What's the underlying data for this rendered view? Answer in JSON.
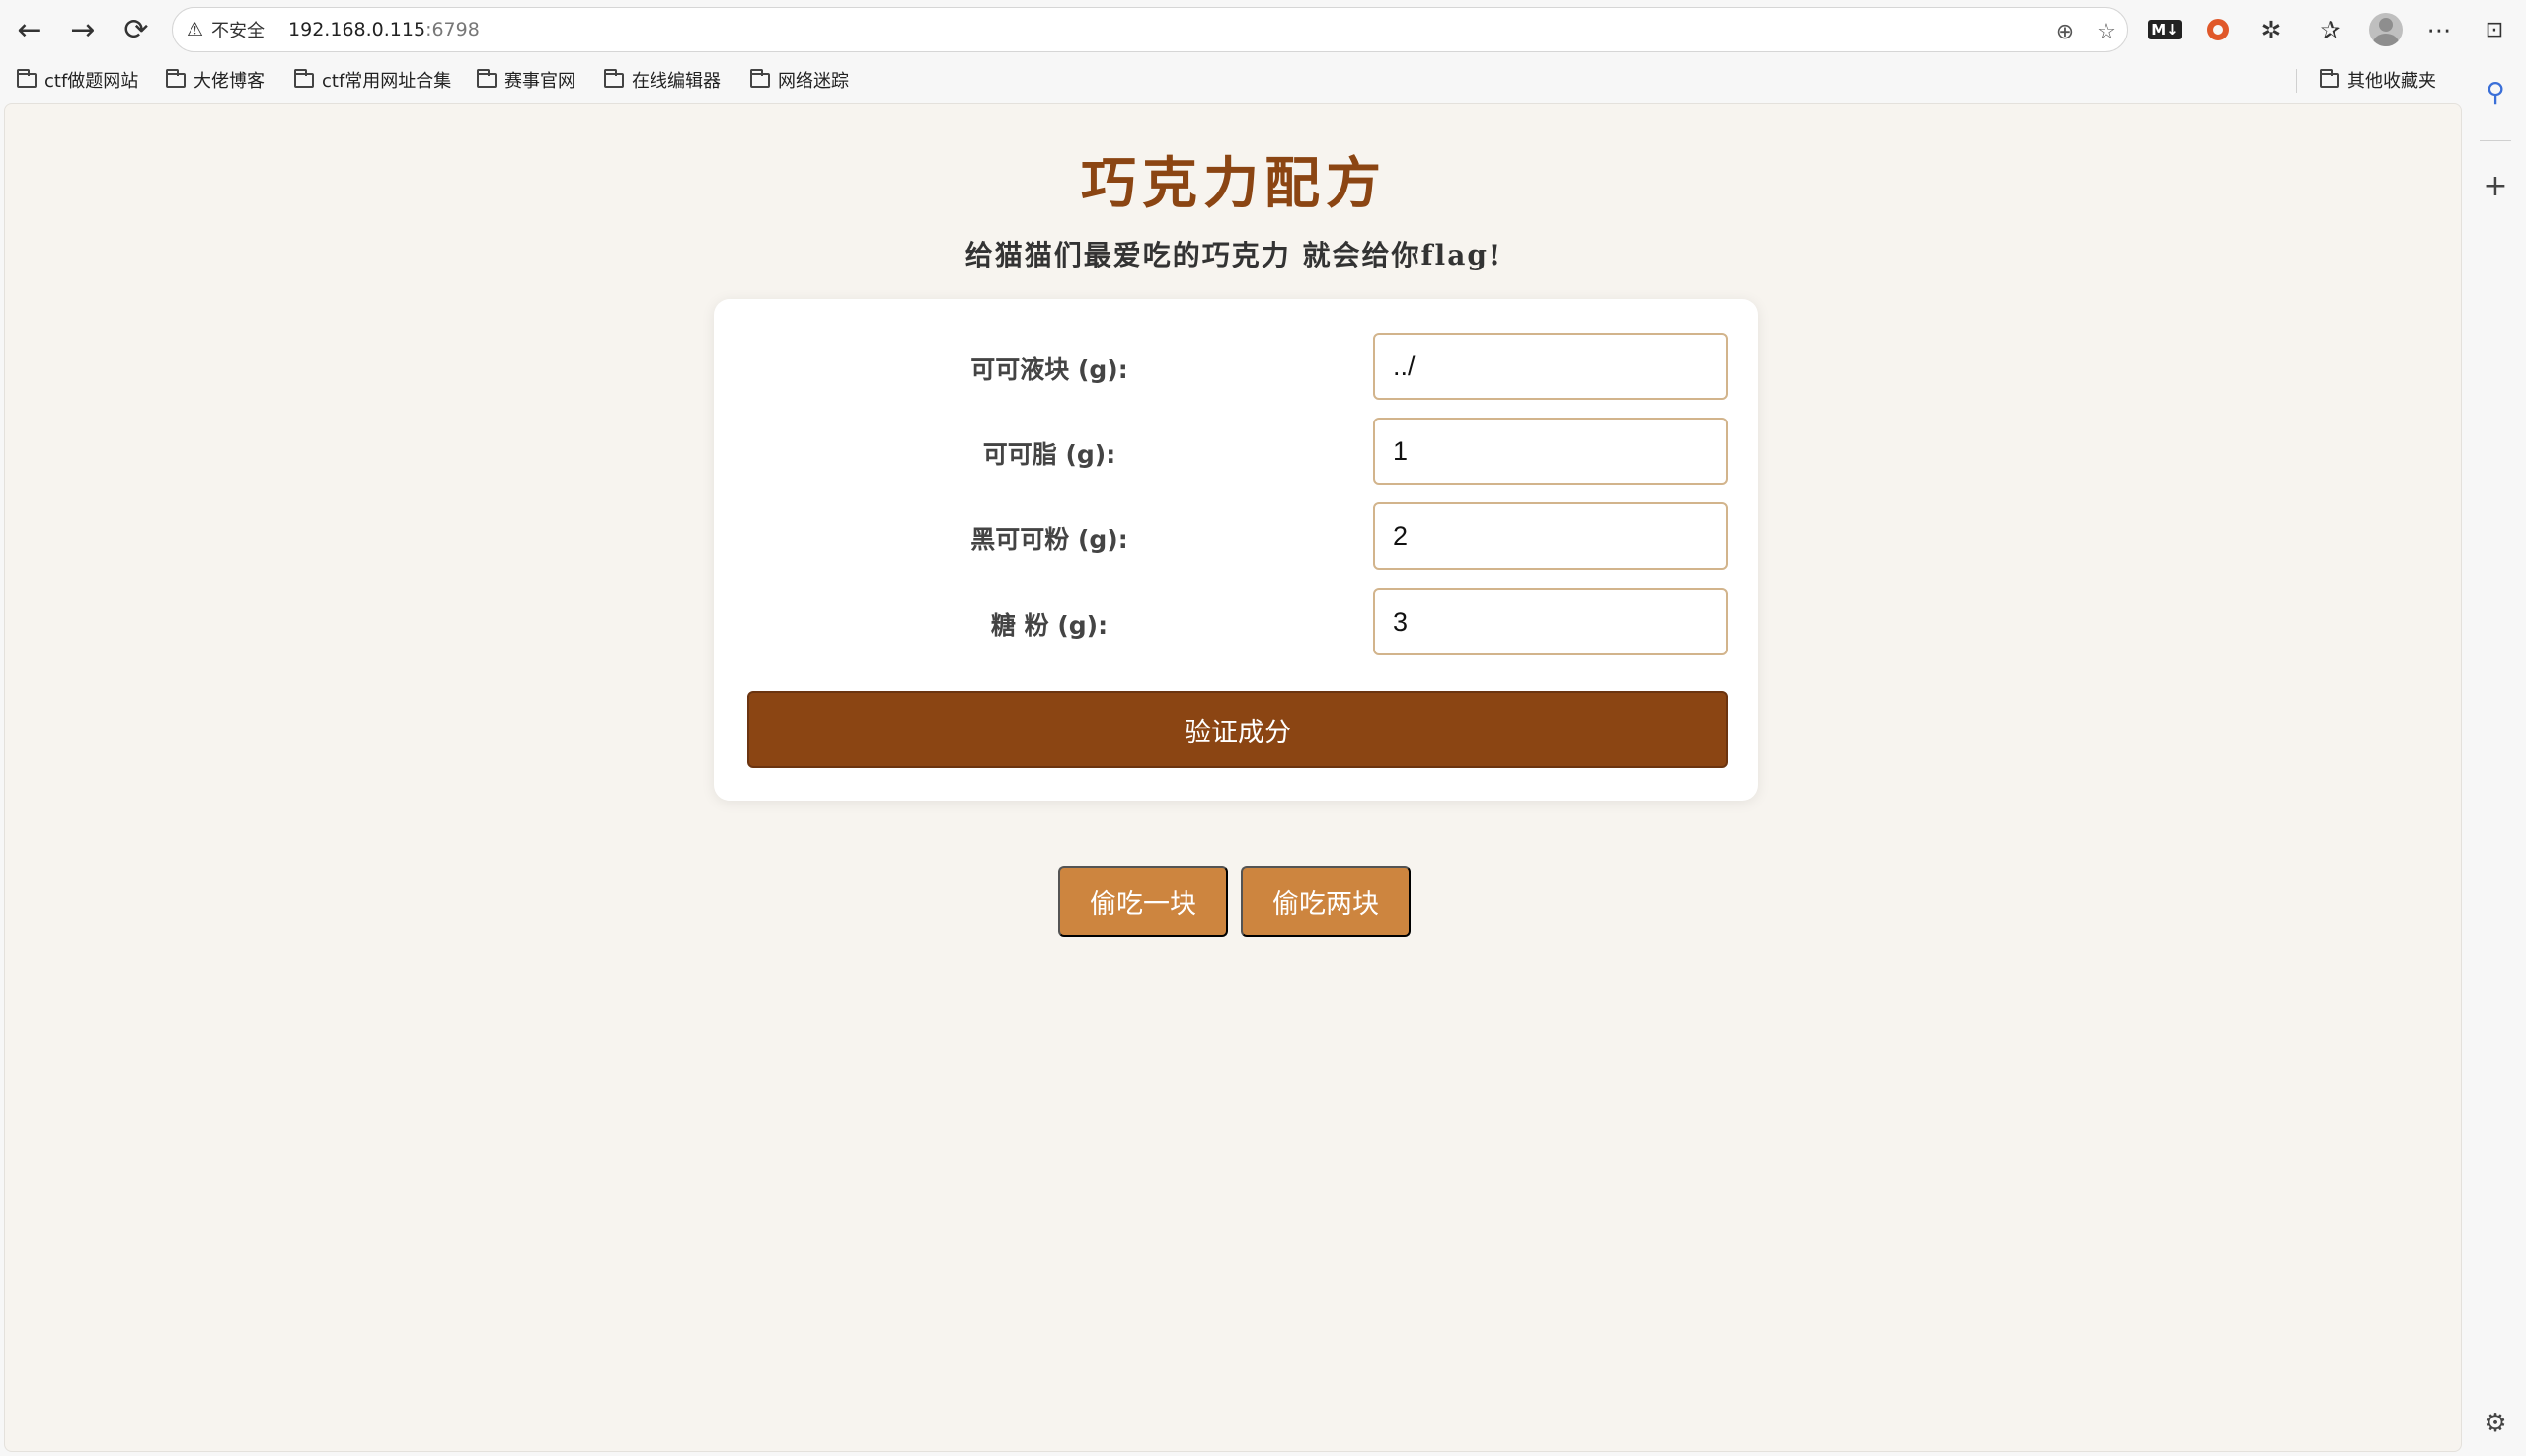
{
  "browser": {
    "insecure_label": "不安全",
    "url_host": "192.168.0.115",
    "url_port": ":6798",
    "bookmarks": [
      "ctf做题网站",
      "大佬博客",
      "ctf常用网址合集",
      "赛事官网",
      "在线编辑器",
      "网络迷踪"
    ],
    "other_bookmarks": "其他收藏夹"
  },
  "page": {
    "title": "巧克力配方",
    "subtitle": "给猫猫们最爱吃的巧克力 就会给你flag!",
    "fields": [
      {
        "label": "可可液块 (g):",
        "value": "../"
      },
      {
        "label": "可可脂 (g):",
        "value": "1"
      },
      {
        "label": "黑可可粉 (g):",
        "value": "2"
      },
      {
        "label": "糖 粉 (g):",
        "value": "3"
      }
    ],
    "verify_button": "验证成分",
    "snack_one": "偷吃一块",
    "snack_two": "偷吃两块"
  },
  "colors": {
    "title": "#8b4513",
    "verify_button": "#8b4513",
    "snack_buttons": "#cd853f",
    "input_border": "#d2b48c",
    "page_background": "#f7f4ef"
  }
}
